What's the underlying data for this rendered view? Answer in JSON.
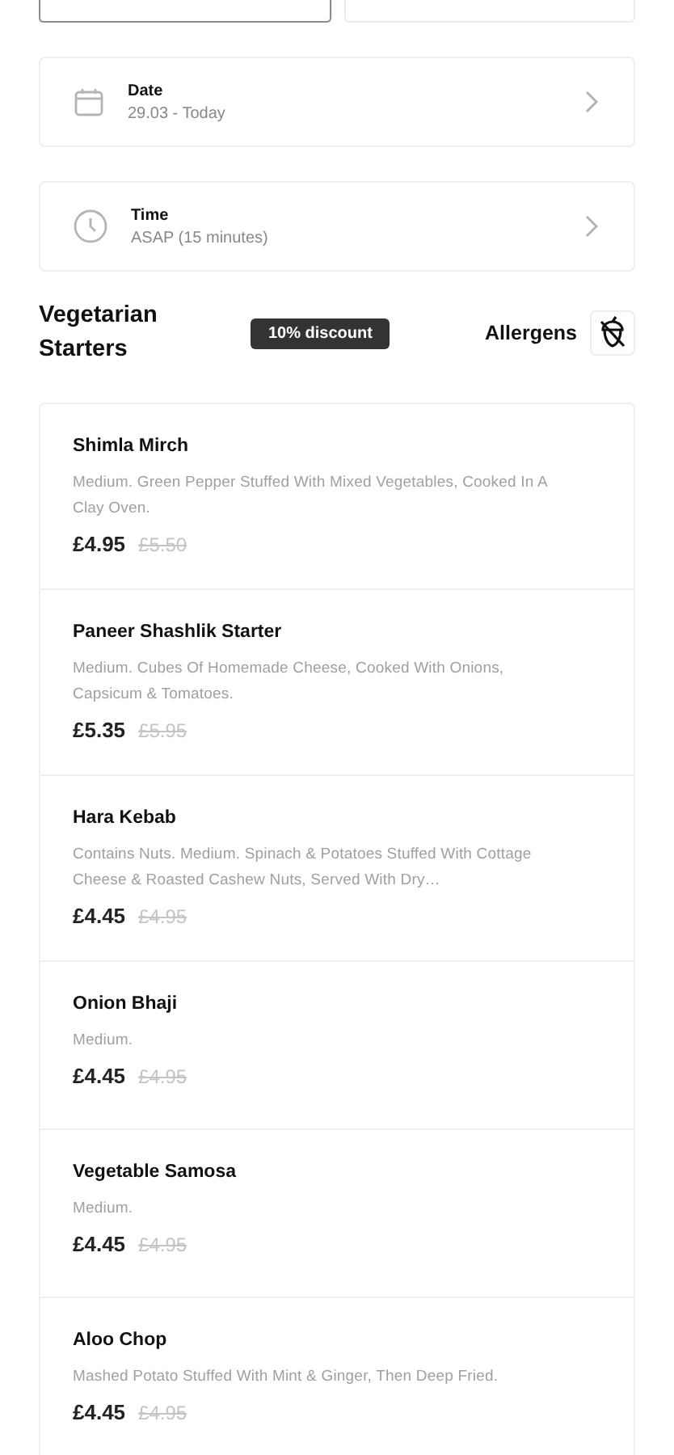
{
  "top_tabs": [
    {
      "selected": true
    },
    {
      "selected": false
    }
  ],
  "date": {
    "label": "Date",
    "value": "29.03 - Today"
  },
  "time": {
    "label": "Time",
    "value": "ASAP (15 minutes)"
  },
  "section": {
    "title": "Vegetarian Starters",
    "badge": "10% discount",
    "allergens_label": "Allergens"
  },
  "items": [
    {
      "name": "Shimla Mirch",
      "description": "Medium. Green Pepper Stuffed With Mixed Vegetables, Cooked In A Clay Oven.",
      "price": "£4.95",
      "old_price": "£5.50"
    },
    {
      "name": "Paneer Shashlik Starter",
      "description": "Medium. Cubes Of Homemade Cheese, Cooked With Onions, Capsicum & Tomatoes.",
      "price": "£5.35",
      "old_price": "£5.95"
    },
    {
      "name": "Hara Kebab",
      "description": "Contains Nuts. Medium. Spinach & Potatoes Stuffed With Cottage Cheese & Roasted Cashew Nuts, Served With Dry…",
      "price": "£4.45",
      "old_price": "£4.95"
    },
    {
      "name": "Onion Bhaji",
      "description": "Medium.",
      "price": "£4.45",
      "old_price": "£4.95"
    },
    {
      "name": "Vegetable Samosa",
      "description": "Medium.",
      "price": "£4.45",
      "old_price": "£4.95"
    },
    {
      "name": "Aloo Chop",
      "description": "Mashed Potato Stuffed With Mint & Ginger, Then Deep Fried.",
      "price": "£4.45",
      "old_price": "£4.95"
    }
  ]
}
